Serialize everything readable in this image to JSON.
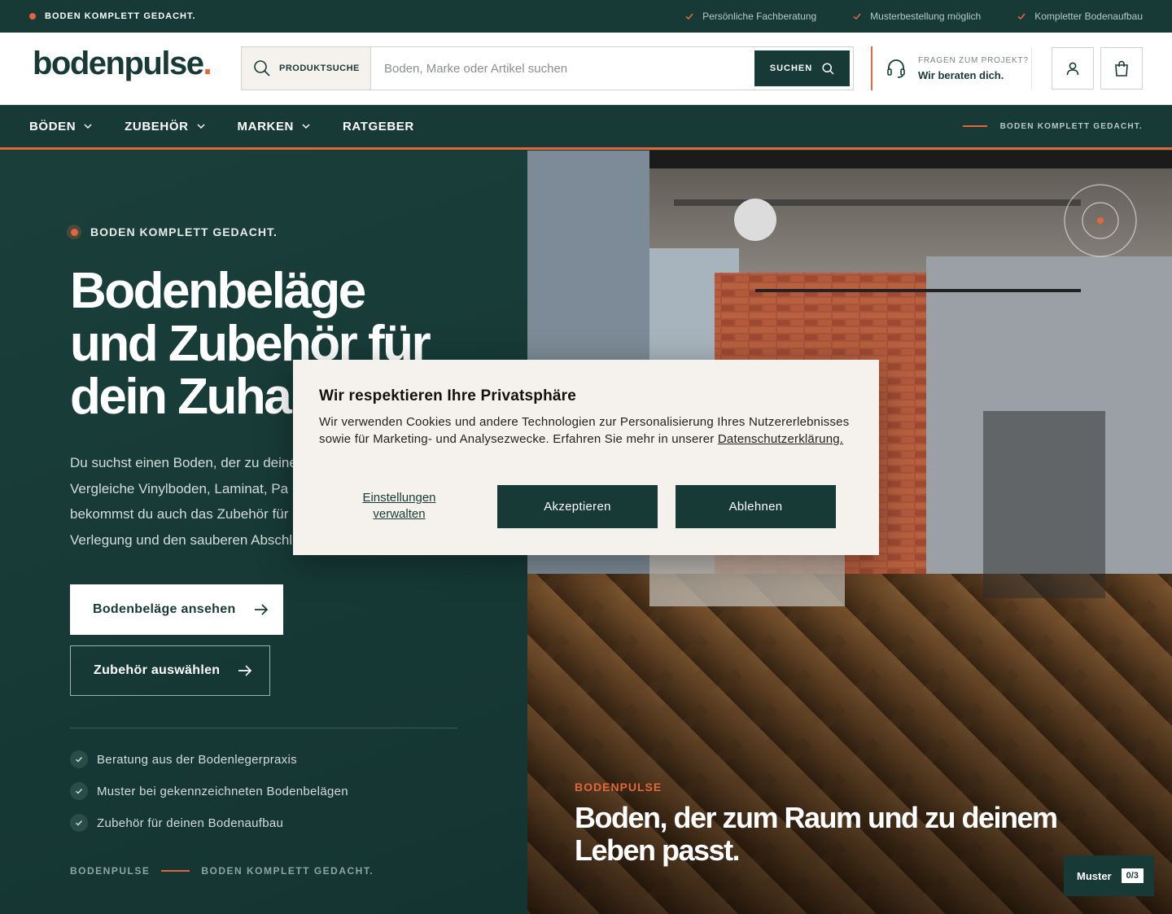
{
  "topbar": {
    "tagline": "BODEN KOMPLETT GEDACHT.",
    "usps": [
      "Persönliche Fachberatung",
      "Musterbestellung möglich",
      "Kompletter Bodenaufbau"
    ]
  },
  "header": {
    "logo_text": "bodenpulse",
    "logo_dot": ".",
    "search_label": "PRODUKTSUCHE",
    "search_placeholder": "Boden, Marke oder Artikel suchen",
    "search_value": "",
    "search_button": "SUCHEN",
    "help_small": "FRAGEN ZUM PROJEKT?",
    "help_big": "Wir beraten dich."
  },
  "nav": {
    "items": [
      {
        "label": "BÖDEN",
        "has_dropdown": true
      },
      {
        "label": "ZUBEHÖR",
        "has_dropdown": true
      },
      {
        "label": "MARKEN",
        "has_dropdown": true
      },
      {
        "label": "RATGEBER",
        "has_dropdown": false
      }
    ],
    "right_tag": "BODEN KOMPLETT GEDACHT."
  },
  "hero": {
    "eyebrow": "BODEN KOMPLETT GEDACHT.",
    "title_line1": "Bodenbeläge",
    "title_line2": "und Zubehör für",
    "title_line3": "dein Zuhau",
    "intro_lines": [
      "Du suchst einen Boden, der zu deine",
      "Vergleiche Vinylboden, Laminat, Pa",
      "bekommst du auch das Zubehör für",
      "Verlegung und den sauberen Abschl"
    ],
    "btn_primary": "Bodenbeläge ansehen",
    "btn_secondary": "Zubehör auswählen",
    "benefits": [
      "Beratung aus der Bodenlegerpraxis",
      "Muster bei gekennzeichneten Bodenbelägen",
      "Zubehör für deinen Bodenaufbau"
    ],
    "footer_brand": "BODENPULSE",
    "footer_tag": "BODEN KOMPLETT GEDACHT.",
    "image_kicker": "BODENPULSE",
    "image_caption": "Boden, der zum Raum und zu deinem Leben passt."
  },
  "muster": {
    "label": "Muster",
    "count": "0/3"
  },
  "cookie": {
    "title": "Wir respektieren Ihre Privatsphäre",
    "text": "Wir verwenden Cookies und andere Technologien zur Personalisierung Ihres Nutzererlebnisses sowie für Marketing- und Analysezwecke. Erfahren Sie mehr in unserer",
    "link": "Datenschutzerklärung.",
    "settings_line1": "Einstellungen",
    "settings_line2": "verwalten",
    "accept": "Akzeptieren",
    "decline": "Ablehnen"
  },
  "colors": {
    "brand": "#173a36",
    "accent": "#e0673a",
    "paper": "#f5f2ed"
  }
}
